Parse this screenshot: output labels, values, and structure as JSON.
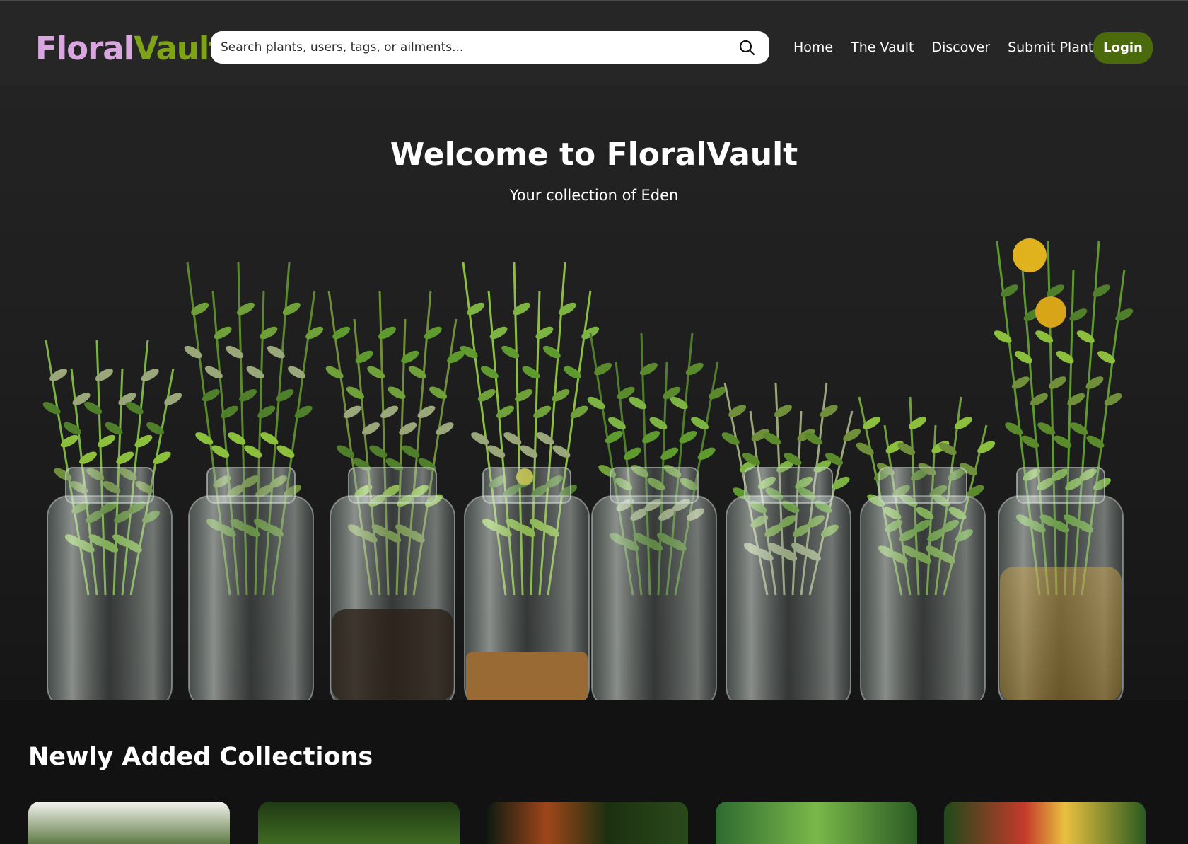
{
  "header": {
    "logo_part1": "Floral",
    "logo_part2": "Vault",
    "search_placeholder": "Search plants, users, tags, or ailments...",
    "nav": [
      "Home",
      "The Vault",
      "Discover",
      "Submit Plant"
    ],
    "login_label": "Login"
  },
  "hero": {
    "title": "Welcome to FloralVault",
    "subtitle": "Your collection of Eden"
  },
  "collections": {
    "title": "Newly Added Collections"
  },
  "colors": {
    "logo_floral": "#d9a6e0",
    "logo_vault": "#7ea317",
    "login_bg": "#4a6a0c",
    "header_bg": "#262626",
    "page_bg": "#121212"
  },
  "icons": [
    "search-icon"
  ]
}
